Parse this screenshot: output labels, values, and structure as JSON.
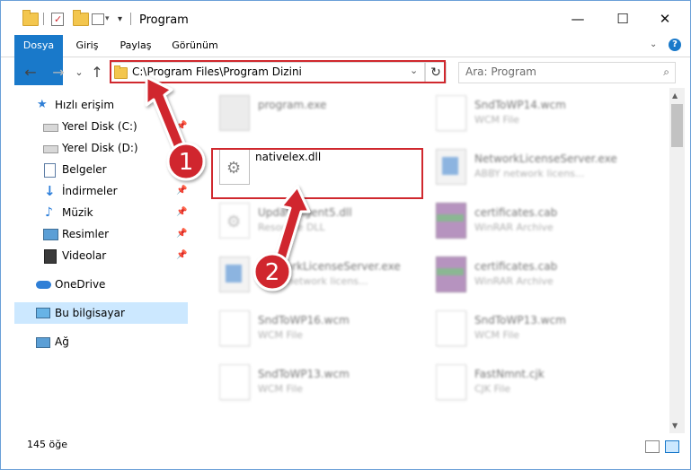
{
  "window": {
    "title": "Program"
  },
  "quick_access": {
    "dropdown_glyph": "▾"
  },
  "controls": {
    "minimize": "—",
    "maximize": "☐",
    "close": "✕"
  },
  "ribbon": {
    "tabs": [
      {
        "label": "Dosya",
        "active": true
      },
      {
        "label": "Giriş"
      },
      {
        "label": "Paylaş"
      },
      {
        "label": "Görünüm"
      }
    ],
    "help": "?"
  },
  "nav": {
    "back": "←",
    "forward": "→",
    "recent": "⌄",
    "up": "↑",
    "address": "C:\\Program Files\\Program Dizini",
    "refresh": "↻",
    "search_placeholder": "Ara: Program",
    "search_icon": "⌕"
  },
  "sidebar": {
    "items": [
      {
        "label": "Hızlı erişim",
        "icon": "star-icon"
      },
      {
        "label": "Yerel Disk (C:)",
        "icon": "drive-icon",
        "pinned": true
      },
      {
        "label": "Yerel Disk (D:)",
        "icon": "drive-icon"
      },
      {
        "label": "Belgeler",
        "icon": "documents-icon",
        "pinned": true
      },
      {
        "label": "İndirmeler",
        "icon": "download-icon",
        "pinned": true
      },
      {
        "label": "Müzik",
        "icon": "music-icon",
        "pinned": true
      },
      {
        "label": "Resimler",
        "icon": "pictures-icon",
        "pinned": true
      },
      {
        "label": "Videolar",
        "icon": "videos-icon",
        "pinned": true
      },
      {
        "label": "OneDrive",
        "icon": "cloud-icon"
      },
      {
        "label": "Bu bilgisayar",
        "icon": "computer-icon",
        "selected": true
      },
      {
        "label": "Ağ",
        "icon": "network-icon"
      }
    ],
    "pin_glyph": "📌"
  },
  "files": [
    {
      "name": "program.exe",
      "type": "",
      "icon": "program-icon"
    },
    {
      "name": "SndToWP14.wcm",
      "type": "WCM File",
      "icon": "file-icon"
    },
    {
      "name": "nativelex.dll",
      "type": "",
      "icon": "dll-icon",
      "highlighted": true
    },
    {
      "name": "NetworkLicenseServer.exe",
      "type": "ABBY network licens...",
      "icon": "exe-icon"
    },
    {
      "name": "UpdateAgent5.dll",
      "type": "Resource DLL",
      "icon": "dll-icon"
    },
    {
      "name": "certificates.cab",
      "type": "WinRAR Archive",
      "icon": "archive-icon"
    },
    {
      "name": "NetworkLicenseServer.exe",
      "type": "ABBY network licens...",
      "icon": "exe-icon"
    },
    {
      "name": "certificates.cab",
      "type": "WinRAR Archive",
      "icon": "archive-icon"
    },
    {
      "name": "SndToWP16.wcm",
      "type": "WCM File",
      "icon": "file-icon"
    },
    {
      "name": "SndToWP13.wcm",
      "type": "WCM File",
      "icon": "file-icon"
    },
    {
      "name": "SndToWP13.wcm",
      "type": "WCM File",
      "icon": "file-icon"
    },
    {
      "name": "FastNmnt.cjk",
      "type": "CJK File",
      "icon": "file-icon"
    }
  ],
  "status": {
    "item_count": "145 öğe"
  },
  "annotations": {
    "step1": "1",
    "step2": "2",
    "color": "#d0282e"
  }
}
